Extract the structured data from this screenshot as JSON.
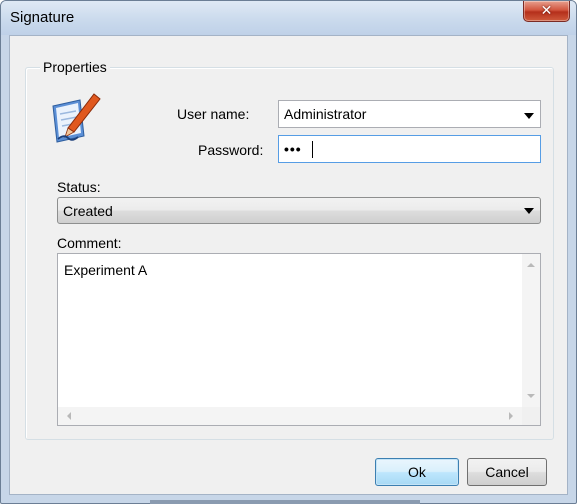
{
  "window": {
    "title": "Signature",
    "close_glyph": "✕"
  },
  "properties": {
    "legend": "Properties",
    "icon": "signature-pen-icon",
    "user_name": {
      "label": "User name:",
      "value": "Administrator"
    },
    "password": {
      "label": "Password:",
      "value": "•••"
    }
  },
  "status": {
    "label": "Status:",
    "value": "Created"
  },
  "comment": {
    "label": "Comment:",
    "value": "Experiment A"
  },
  "buttons": {
    "ok": "Ok",
    "cancel": "Cancel"
  },
  "colors": {
    "title_bar": "#c9d9ec",
    "close_button": "#c8442f",
    "default_button_border": "#3c7fb1"
  }
}
